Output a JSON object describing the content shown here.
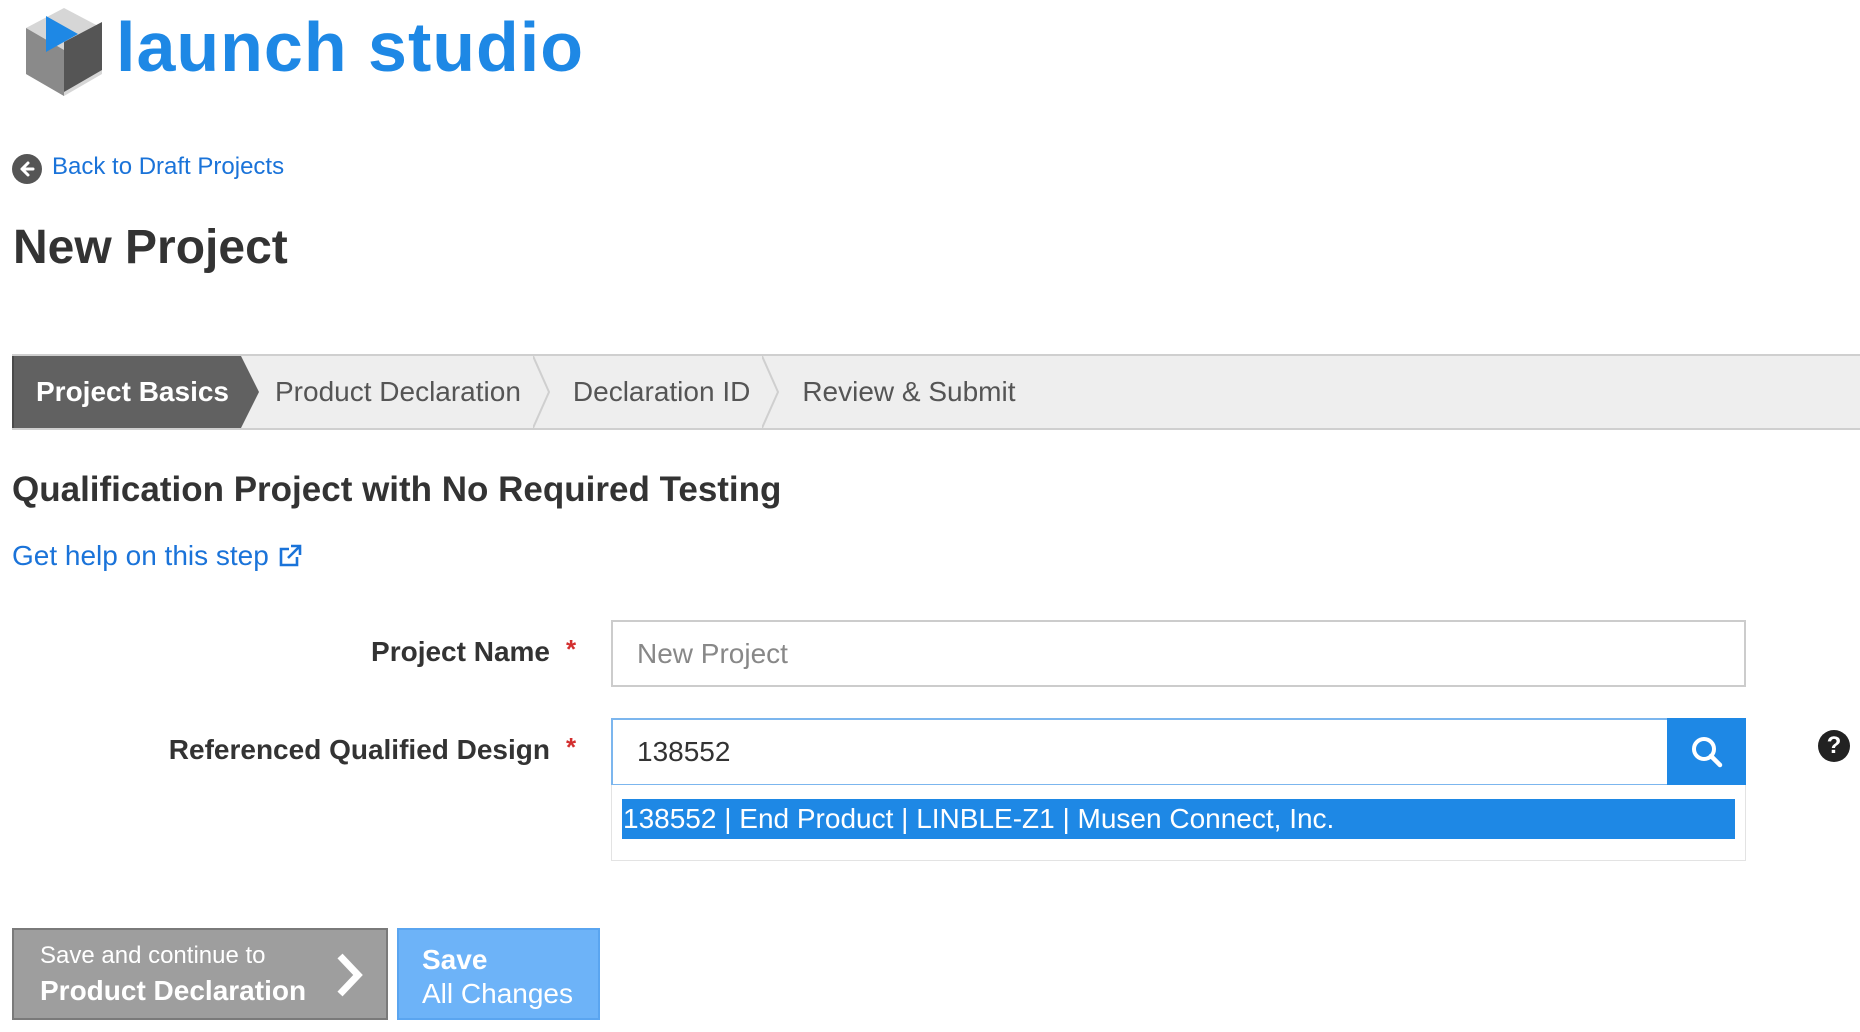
{
  "brand": {
    "name": "launch studio",
    "logo_icon": "cube-play-icon",
    "accent_color": "#1e88e5"
  },
  "nav": {
    "back_link": "Back to Draft Projects",
    "back_icon": "arrow-left-circle-icon"
  },
  "page": {
    "title": "New Project"
  },
  "steps": [
    {
      "label": "Project Basics",
      "active": true
    },
    {
      "label": "Product Declaration",
      "active": false
    },
    {
      "label": "Declaration ID",
      "active": false
    },
    {
      "label": "Review & Submit",
      "active": false
    }
  ],
  "section": {
    "title": "Qualification Project with No Required Testing",
    "help_link": "Get help on this step",
    "help_icon": "external-link-icon"
  },
  "form": {
    "project_name": {
      "label": "Project Name",
      "required_mark": "*",
      "value": "",
      "placeholder": "New Project"
    },
    "referenced_design": {
      "label": "Referenced Qualified Design",
      "required_mark": "*",
      "value": "138552",
      "search_icon": "search-icon",
      "help_icon": "question-circle-icon",
      "suggestions": [
        "138552 | End Product | LINBLE-Z1 | Musen Connect, Inc."
      ]
    }
  },
  "actions": {
    "continue_line1": "Save and continue to",
    "continue_line2": "Product Declaration",
    "continue_icon": "chevron-right-icon",
    "save_line1": "Save",
    "save_line2": "All Changes"
  }
}
